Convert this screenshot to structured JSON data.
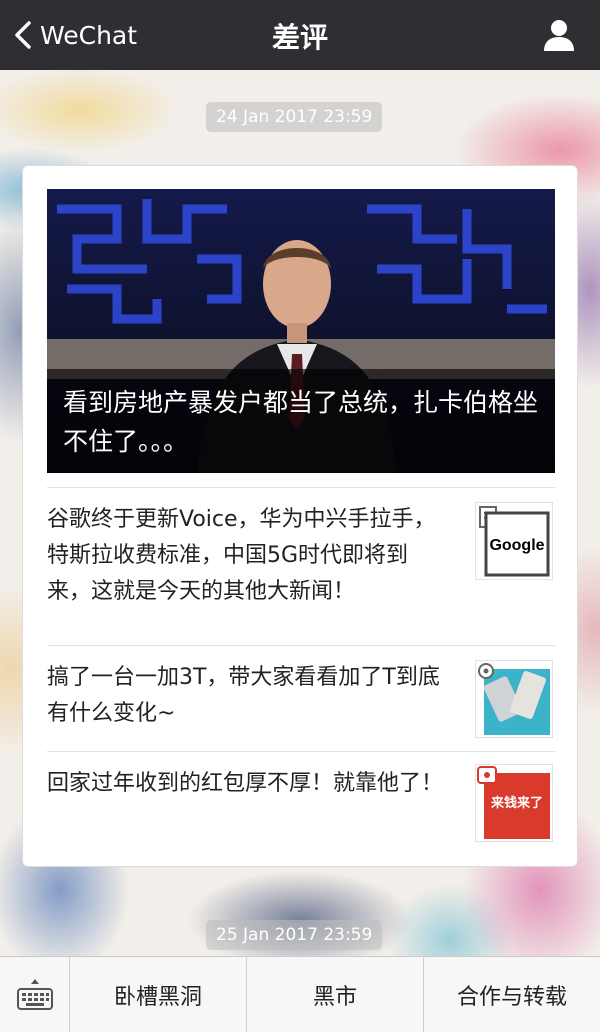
{
  "navbar": {
    "back_label": "WeChat",
    "title": "差评"
  },
  "timestamps": [
    "24 Jan 2017 23:59",
    "25 Jan 2017 23:59"
  ],
  "card": {
    "hero": {
      "title": "看到房地产暴发户都当了总统，扎卡伯格坐不住了。。。",
      "image": "man-in-suit-speaking-photo"
    },
    "articles": [
      {
        "title": "谷歌终于更新Voice，华为中兴手拉手，特斯拉收费标准，中国5G时代即将到来，这就是今天的其他大新闻！",
        "thumb_text": "Google",
        "thumb_icon": "document-icon"
      },
      {
        "title": "搞了一台一加3T，带大家看看加了T到底有什么变化~",
        "thumb_icon": "gear-icon"
      },
      {
        "title": "回家过年收到的红包厚不厚！就靠他了！",
        "thumb_text": "来钱来了",
        "thumb_icon": "red-envelope-icon"
      }
    ]
  },
  "menu": {
    "keyboard_icon": "keyboard-icon",
    "items": [
      "卧槽黑洞",
      "黑市",
      "合作与转载"
    ]
  },
  "colors": {
    "navbar": "#2f2f33",
    "card": "#ffffff",
    "menu": "#f7f7f7"
  }
}
